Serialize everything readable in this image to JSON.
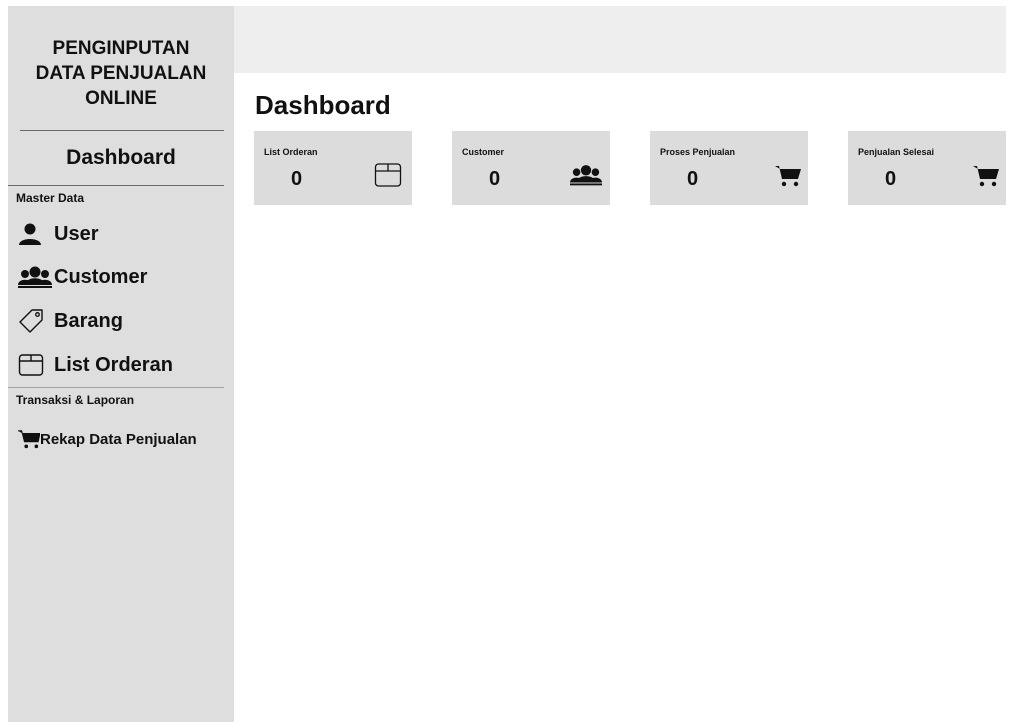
{
  "sidebar": {
    "brand_lines": [
      "PENGINPUTAN",
      "DATA PENJUALAN",
      "ONLINE"
    ],
    "dashboard_label": "Dashboard",
    "master_section": "Master Data",
    "items": [
      {
        "label": "User",
        "icon": "user-icon"
      },
      {
        "label": "Customer",
        "icon": "customers-icon"
      },
      {
        "label": "Barang",
        "icon": "tag-icon"
      },
      {
        "label": "List Orderan",
        "icon": "box-icon"
      }
    ],
    "report_section": "Transaksi & Laporan",
    "report_items": [
      {
        "label": "Rekap Data Penjualan",
        "icon": "cart-icon"
      }
    ]
  },
  "main": {
    "title": "Dashboard",
    "cards": [
      {
        "label": "List Orderan",
        "value": "0",
        "icon": "box-icon"
      },
      {
        "label": "Customer",
        "value": "0",
        "icon": "customers-icon"
      },
      {
        "label": "Proses Penjualan",
        "value": "0",
        "icon": "cart-icon"
      },
      {
        "label": "Penjualan Selesai",
        "value": "0",
        "icon": "cart-icon"
      }
    ]
  },
  "colors": {
    "sidebar_bg": "#dedede",
    "topbar_bg": "#eeeeee",
    "card_bg": "#dcdcdc",
    "text": "#111111"
  }
}
